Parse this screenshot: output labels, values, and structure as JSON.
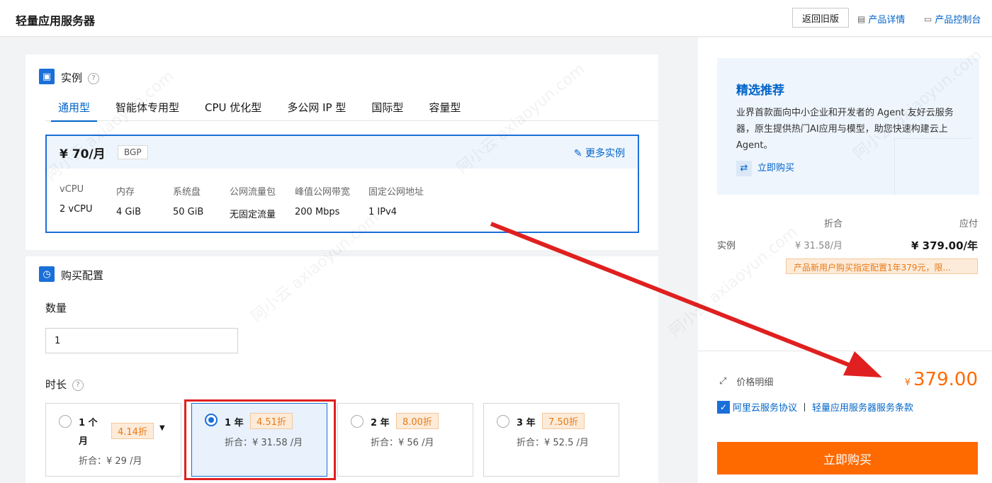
{
  "header": {
    "title": "轻量应用服务器",
    "old_version": "返回旧版",
    "product_detail": "产品详情",
    "product_console": "产品控制台"
  },
  "instance": {
    "section_title": "实例",
    "tabs": [
      "通用型",
      "智能体专用型",
      "CPU 优化型",
      "多公网 IP 型",
      "国际型",
      "容量型"
    ],
    "price": "¥ 70/月",
    "network": "BGP",
    "more": "更多实例",
    "specs": [
      {
        "k": "vCPU",
        "v": "2 vCPU"
      },
      {
        "k": "内存",
        "v": "4 GiB"
      },
      {
        "k": "系统盘",
        "v": "50 GiB"
      },
      {
        "k": "公网流量包",
        "v": "无固定流量"
      },
      {
        "k": "峰值公网带宽",
        "v": "200 Mbps"
      },
      {
        "k": "固定公网地址",
        "v": "1 IPv4"
      }
    ]
  },
  "purchase": {
    "section_title": "购买配置",
    "quantity_label": "数量",
    "quantity_value": "1",
    "duration_label": "时长",
    "options": [
      {
        "name1": "1 个",
        "name2": "月",
        "badge": "4.14折",
        "disc": "折合：¥ 29 /月",
        "selected": false
      },
      {
        "name1": "1 年",
        "badge": "4.51折",
        "disc": "折合：¥ 31.58 /月",
        "selected": true
      },
      {
        "name1": "2 年",
        "badge": "8.00折",
        "disc": "折合：¥ 56 /月",
        "selected": false
      },
      {
        "name1": "3 年",
        "badge": "7.50折",
        "disc": "折合：¥ 52.5 /月",
        "selected": false
      }
    ]
  },
  "sidebar": {
    "reco_title": "精选推荐",
    "reco_desc": "业界首款面向中小企业和开发者的 Agent 友好云服务器，原生提供热门AI应用与模型，助您快速构建云上 Agent。",
    "reco_buy": "立即购买",
    "col_discount": "折合",
    "col_pay": "应付",
    "row_label": "实例",
    "row_discount": "¥ 31.58/月",
    "row_pay": "¥ 379.00/年",
    "promo": "产品新用户购买指定配置1年379元，限...",
    "price_detail": "价格明细",
    "currency": "¥",
    "total": "379.00",
    "agreement1": "阿里云服务协议",
    "agreement2": "轻量应用服务器服务条款",
    "buy_now": "立即购买"
  },
  "watermark": "阿小云 axiaoyun.com",
  "colors": {
    "accent": "#1a6fd8",
    "orange": "#ff6a00",
    "annotation": "#e02020"
  }
}
